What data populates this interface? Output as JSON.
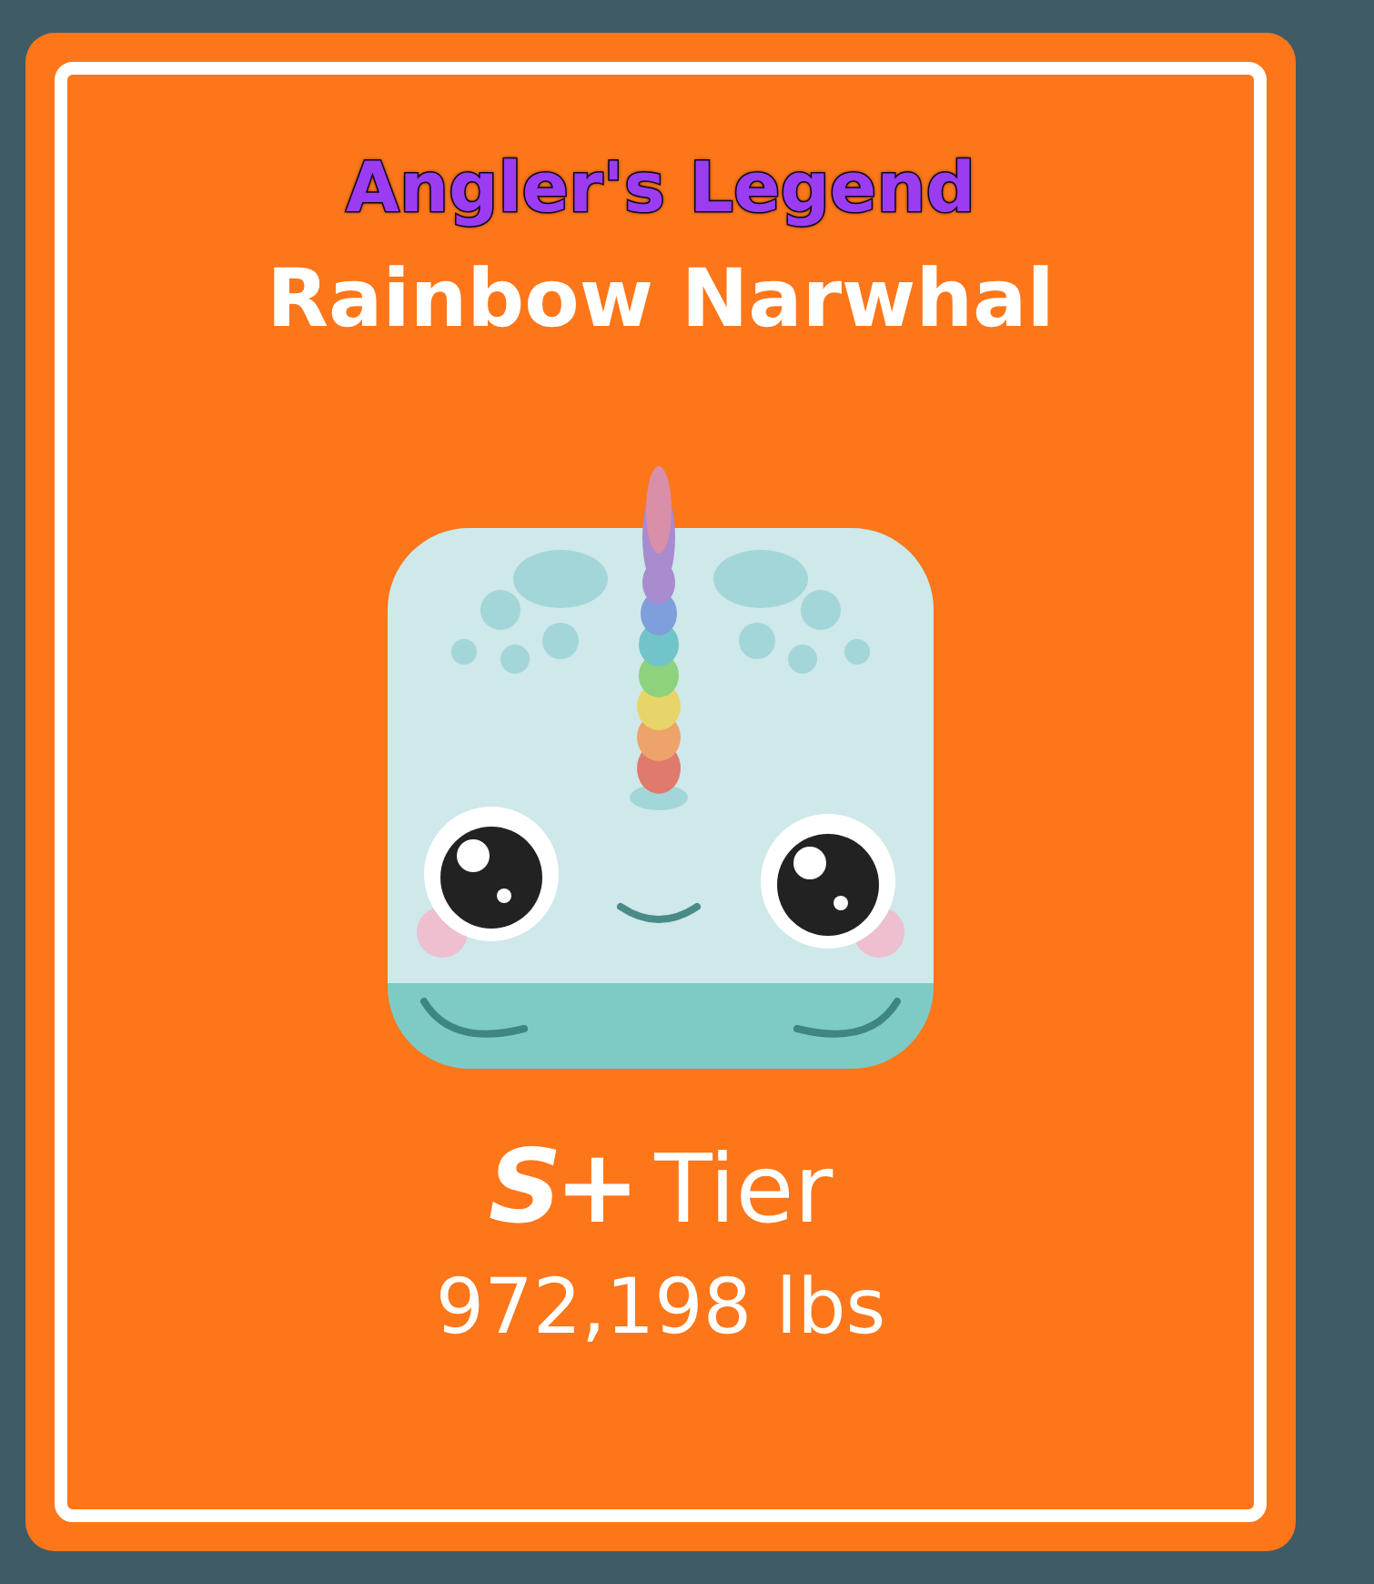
{
  "card": {
    "rarity": "Angler's Legend",
    "name": "Rainbow Narwhal",
    "tier": "S+",
    "tier_label": "Tier",
    "weight": "972,198 lbs"
  }
}
